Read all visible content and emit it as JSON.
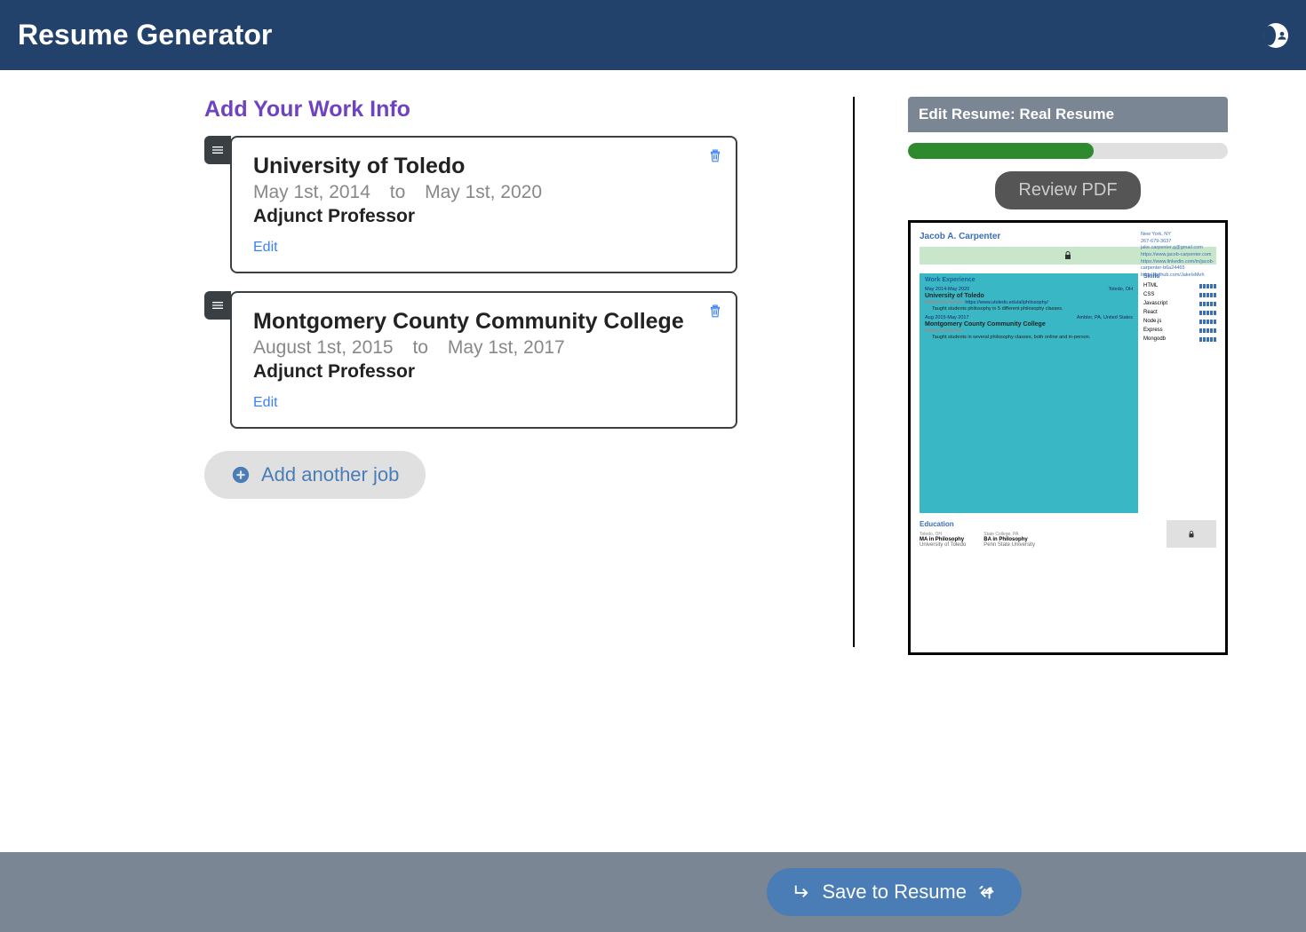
{
  "header": {
    "title": "Resume Generator"
  },
  "section": {
    "title": "Add Your Work Info"
  },
  "jobs": [
    {
      "company": "University of Toledo",
      "start": "May 1st, 2014",
      "to": "to",
      "end": "May 1st, 2020",
      "role": "Adjunct Professor",
      "edit": "Edit"
    },
    {
      "company": "Montgomery County Community College",
      "start": "August 1st, 2015",
      "to": "to",
      "end": "May 1st, 2017",
      "role": "Adjunct Professor",
      "edit": "Edit"
    }
  ],
  "add_job_label": "Add another job",
  "right": {
    "edit_label": "Edit Resume: Real Resume",
    "review_label": "Review PDF",
    "progress_pct": 58
  },
  "preview": {
    "name": "Jacob A. Carpenter",
    "contact": {
      "loc": "New York, NY",
      "phone": "267-679-3637",
      "email": "jake.carpenter.g@gmail.com",
      "url1": "https://www.jacob-carpenter.com",
      "url2": "https://www.linkedin.com/in/jacob-carpenter-b6a24465",
      "url3": "https://github.com/JakeIsMeh"
    },
    "work_header": "Work Experience",
    "exp": [
      {
        "date_range": "May 2014-May 2020",
        "location": "Toledo, OH",
        "company": "University of Toledo",
        "role": "Adjunct Professor",
        "link": "https://www.utoledo.edu/al/philosophy/",
        "desc": "Taught students philosophy in 5 different philosophy classes."
      },
      {
        "date_range": "Aug 2015-May 2017",
        "location": "Ambler, PA, United States",
        "company": "Montgomery County Community College",
        "role": "Adjunct Professor",
        "link": "",
        "desc": "Taught students in several philosophy classes, both online and in-person."
      }
    ],
    "skills_header": "Skills",
    "skills": [
      "HTML",
      "CSS",
      "Javascript",
      "React",
      "Node.js",
      "Express",
      "Mongodb"
    ],
    "edu_header": "Education",
    "edu": [
      {
        "loc": "Toledo, OH",
        "degree": "MA in Philosophy",
        "school": "University of Toledo"
      },
      {
        "loc": "State College, PA",
        "degree": "BA in Philosophy",
        "school": "Penn State University"
      }
    ]
  },
  "footer": {
    "save_label": "Save to Resume"
  }
}
